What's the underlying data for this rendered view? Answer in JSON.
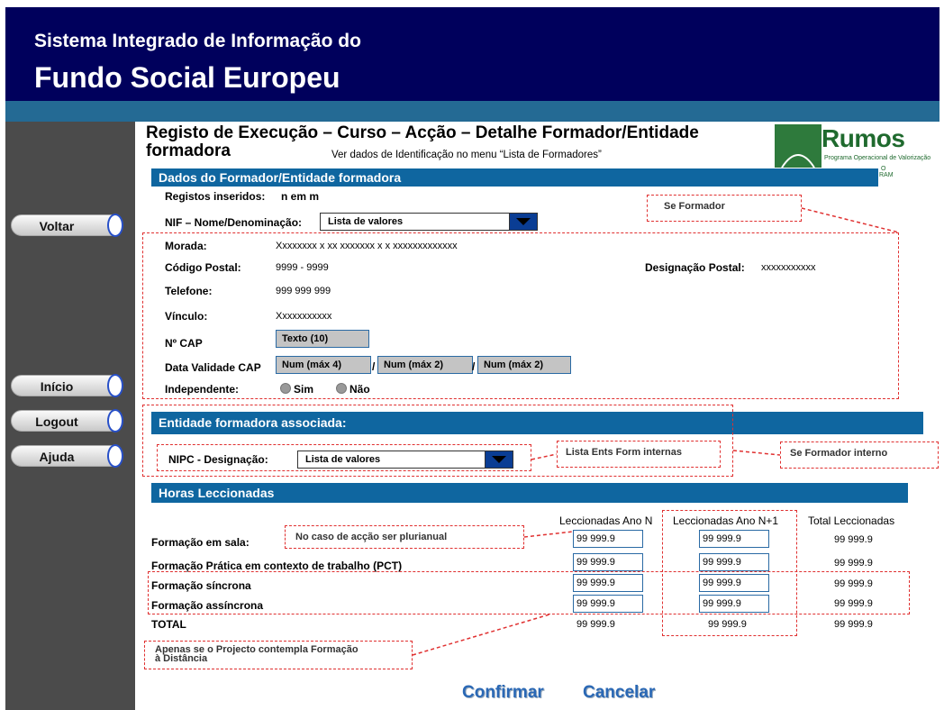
{
  "header": {
    "line1": "Sistema Integrado de Informação do",
    "line2": "Fundo Social Europeu"
  },
  "sidebar": {
    "voltar": "Voltar",
    "inicio": "Início",
    "logout": "Logout",
    "ajuda": "Ajuda"
  },
  "page": {
    "title_line1": "Registo de Execução – Curso – Acção – Detalhe Formador/Entidade",
    "title_line2": "formadora",
    "subtitle": "Ver dados de Identificação no menu “Lista de Formadores”"
  },
  "logo": {
    "name": "Rumos",
    "tagline": "Programa Operacional de Valorização",
    "fragment1": "O",
    "fragment2": "RAM"
  },
  "formador": {
    "section": "Dados do Formador/Entidade formadora",
    "registos_label": "Registos inseridos:",
    "registos_value": "n em m",
    "nif_label": "NIF – Nome/Denominação:",
    "nif_select": "Lista de valores",
    "morada_label": "Morada:",
    "morada_value": "Xxxxxxxx x xx xxxxxxx x x xxxxxxxxxxxxx",
    "cp_label": "Código Postal:",
    "cp_value": "9999 - 9999",
    "desig_label": "Designação Postal:",
    "desig_value": "xxxxxxxxxxx",
    "tel_label": "Telefone:",
    "tel_value": "999 999 999",
    "vinculo_label": "Vínculo:",
    "vinculo_value": "Xxxxxxxxxxx",
    "cap_label": "Nº CAP",
    "cap_value": "Texto (10)",
    "validade_label": "Data Validade CAP",
    "validade_y": "Num (máx 4)",
    "validade_m": "Num (máx 2)",
    "validade_d": "Num (máx 2)",
    "sep": "/",
    "indep_label": "Independente:",
    "sim": "Sim",
    "nao": "Não"
  },
  "entidade": {
    "section": "Entidade formadora associada:",
    "nipc_label": "NIPC - Designação:",
    "nipc_select": "Lista de valores"
  },
  "notes": {
    "se_formador": "Se Formador",
    "lista_ents": "Lista Ents Form internas",
    "se_interno": "Se Formador interno",
    "plurianual": "No caso de acção ser plurianual",
    "distancia1": "Apenas se o Projecto contempla Formação",
    "distancia2": "à Distância"
  },
  "horas": {
    "section": "Horas Leccionadas",
    "col_n": "Leccionadas Ano N",
    "col_n1": "Leccionadas Ano N+1",
    "col_total": "Total Leccionadas",
    "rows": [
      {
        "label": "Formação em sala:",
        "n": "99 999.9",
        "n1": "99 999.9",
        "total": "99 999.9"
      },
      {
        "label": "Formação Prática em contexto de trabalho  (PCT)",
        "n": "99 999.9",
        "n1": "99 999.9",
        "total": "99 999.9"
      },
      {
        "label": "Formação síncrona",
        "n": "99 999.9",
        "n1": "99 999.9",
        "total": "99 999.9"
      },
      {
        "label": "Formação assíncrona",
        "n": "99 999.9",
        "n1": "99 999.9",
        "total": "99 999.9"
      },
      {
        "label": "TOTAL",
        "n": "99 999.9",
        "n1": "99 999.9",
        "total": "99 999.9"
      }
    ]
  },
  "actions": {
    "confirmar": "Confirmar",
    "cancelar": "Cancelar"
  }
}
